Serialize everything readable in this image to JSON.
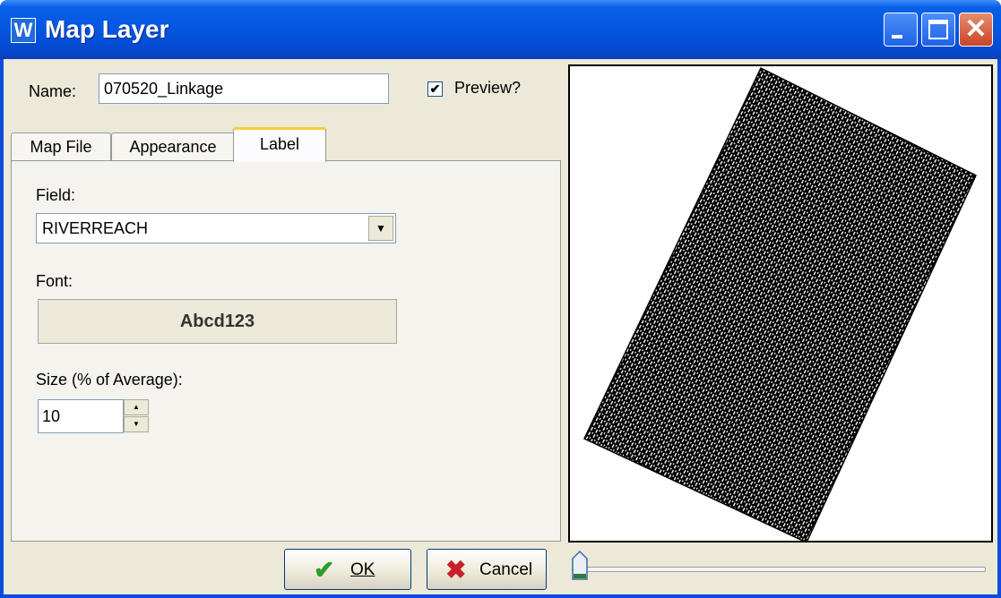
{
  "window": {
    "title": "Map Layer",
    "icon_letter": "W"
  },
  "name_field": {
    "label": "Name:",
    "value": "070520_Linkage"
  },
  "preview_checkbox": {
    "label": "Preview?",
    "checked": true
  },
  "tabs": [
    {
      "label": "Map File",
      "active": false
    },
    {
      "label": "Appearance",
      "active": false
    },
    {
      "label": "Label",
      "active": true
    }
  ],
  "label_tab": {
    "field_label": "Field:",
    "field_value": "RIVERREACH",
    "font_label": "Font:",
    "font_sample": "Abcd123",
    "size_label": "Size (% of Average):",
    "size_value": "10"
  },
  "buttons": {
    "ok_label": "OK",
    "cancel_label": "Cancel"
  },
  "slider": {
    "value": 0
  }
}
